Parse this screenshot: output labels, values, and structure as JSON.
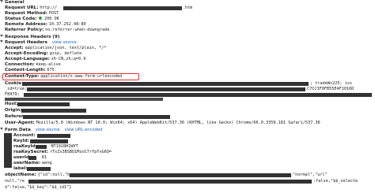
{
  "general": {
    "heading": "General",
    "request_url_label": "Request URL:",
    "request_url_prefix": "http://",
    "request_url_suffix": ".htm",
    "request_method_label": "Request Method:",
    "request_method": "POST",
    "status_code_label": "Status Code:",
    "status_code": "200 OK",
    "remote_address_label": "Remote Address:",
    "remote_address": "10.37.252.48:80",
    "referrer_policy_label": "Referrer Policy:",
    "referrer_policy": "no-referrer-when-downgrade"
  },
  "response_headers": {
    "heading": "Response Headers (9)"
  },
  "request_headers": {
    "heading": "Request Headers",
    "view_source": "view source",
    "accept_label": "Accept:",
    "accept": "application/json, text/plain, */*",
    "accept_encoding_label": "Accept-Encoding:",
    "accept_encoding": "gzip, deflate",
    "accept_language_label": "Accept-Language:",
    "accept_language": "zh-CN,zh;q=0.9",
    "connection_label": "Connection:",
    "connection": "keep-alive",
    "content_length_label": "Content-Length:",
    "content_length": "675",
    "content_type_label": "Content-Type:",
    "content_type": "application/x-www-form-urlencoded",
    "cookie_label": "Cookie:",
    "cookie_tail_1": "; tradeWx225; iss",
    "cookie_line2_prefix": "_id=true;",
    "cookie_line2_tail": "C7CC3F0FB55E4F1016D",
    "cookie_line3_prefix": "F8979;",
    "host_label": "Host:",
    "origin_label": "Origin:",
    "referer_label": "Referer:",
    "user_agent_label": "User-Agent:",
    "user_agent": "Mozilla/5.0 (Windows NT 10.0; Win64; x64) AppleWebKit/537.36 (KHTML, like Gecko) Chrome/66.0.3359.181 Safari/537.36"
  },
  "form_data": {
    "heading": "Form Data",
    "view_source": "view source",
    "view_url_encoded": "view URL encoded",
    "field1_label": "Account:",
    "field2_label": "KeyId:",
    "field3_label": "rsaKeyId:",
    "field3_value": "NT1928H1WVT",
    "field4_label": "rsaKeySecret:",
    "field4_value": "rTxZs3BSBQ1MzoC7rYpYvG6Q=",
    "field5_label": "userId:",
    "field5_value": "81",
    "field6_label": "userName:",
    "field6_value": "weng",
    "field7_label": "label:",
    "object_label": "objectName:",
    "object_value_1": "{\"id\":null,\"b",
    "object_value_1b": "\"normal\",\"url\"",
    "object_value_2": "null,\"re",
    "object_value_2b": ":false,\"$$_selecte",
    "object_value_3": "d\":false,\"$$_key\":\"$$_id1\"}"
  }
}
